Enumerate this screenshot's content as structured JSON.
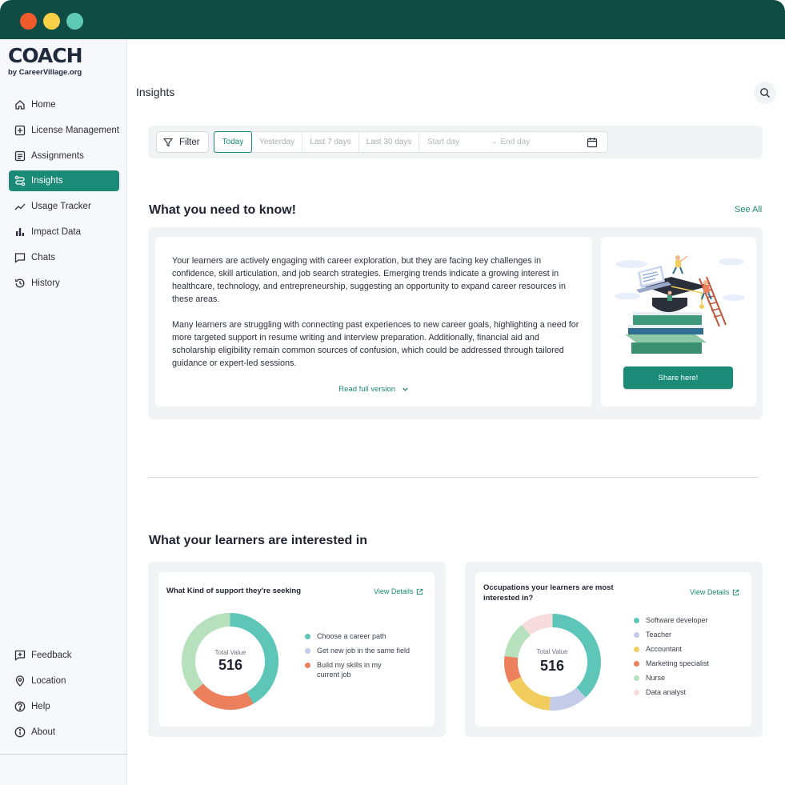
{
  "brand": {
    "logo": "COACH",
    "byline": "by CareerVillage.org"
  },
  "sidebar": {
    "items": [
      {
        "label": "Home",
        "icon": "home-icon"
      },
      {
        "label": "License Management",
        "icon": "plus-square-icon"
      },
      {
        "label": "Assignments",
        "icon": "list-icon"
      },
      {
        "label": "Insights",
        "icon": "route-icon",
        "active": true
      },
      {
        "label": "Usage Tracker",
        "icon": "trend-line-icon"
      },
      {
        "label": "Impact Data",
        "icon": "bar-chart-icon"
      },
      {
        "label": "Chats",
        "icon": "chat-icon"
      },
      {
        "label": "History",
        "icon": "history-icon"
      }
    ],
    "bottom_items": [
      {
        "label": "Feedback",
        "icon": "feedback-icon"
      },
      {
        "label": "Location",
        "icon": "location-pin-icon"
      },
      {
        "label": "Help",
        "icon": "help-icon"
      },
      {
        "label": "About",
        "icon": "info-icon"
      }
    ]
  },
  "header": {
    "title": "Insights"
  },
  "filters": {
    "filter_label": "Filter",
    "ranges": [
      "Today",
      "Yesterday",
      "Last 7 days",
      "Last 30 days"
    ],
    "active_range": "Today",
    "start_placeholder": "Start day",
    "end_placeholder": "End day"
  },
  "know": {
    "title": "What you need to know!",
    "see_all": "See All",
    "paragraph1": "Your learners are actively engaging with career exploration, but they are facing key challenges in confidence, skill articulation, and job search strategies. Emerging trends indicate a growing interest in healthcare, technology, and entrepreneurship, suggesting an opportunity to expand career resources in these areas.",
    "paragraph2": "Many learners are struggling with connecting past experiences to new career goals, highlighting a need for more targeted support in resume writing and interview preparation. Additionally, financial aid and scholarship eligibility remain common sources of confusion, which could be addressed through tailored guidance or expert-led sessions.",
    "read_full": "Read full version",
    "share_label": "Share here!"
  },
  "interests": {
    "title": "What your learners are interested in",
    "support_card": {
      "title": "What Kind of support they're seeking",
      "view_details": "View Details",
      "total_label": "Total Value",
      "total_value": "516",
      "segments": [
        {
          "label": "Choose a career path",
          "color": "#5ec6b8",
          "share": 0.42
        },
        {
          "label": "Get new job in the same field",
          "color": "#c3cbe8",
          "share": 0.0
        },
        {
          "label": "Build my skills in my current job",
          "color": "#ec7f5c",
          "share": 0.22
        },
        {
          "label": "",
          "color": "#b7e0bd",
          "share": 0.36
        }
      ]
    },
    "occupations_card": {
      "title": "Occupations your learners are most interested in?",
      "view_details": "View Details",
      "total_label": "Total Value",
      "total_value": "516",
      "segments": [
        {
          "label": "Software developer",
          "color": "#5ec6b8",
          "share": 0.38
        },
        {
          "label": "Teacher",
          "color": "#c3cbe8",
          "share": 0.13
        },
        {
          "label": "Accountant",
          "color": "#f2cd5e",
          "share": 0.17
        },
        {
          "label": "Marketing specialist",
          "color": "#ec7f5c",
          "share": 0.09
        },
        {
          "label": "Nurse",
          "color": "#b7e0bd",
          "share": 0.12
        },
        {
          "label": "Data analyst",
          "color": "#f6dcdc",
          "share": 0.11
        }
      ]
    }
  }
}
